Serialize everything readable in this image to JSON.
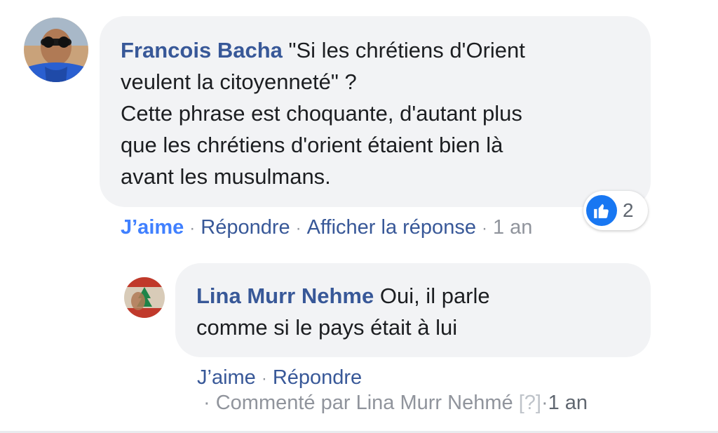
{
  "comment": {
    "author": "Francois Bacha",
    "text": "\"Si les chrétiens d'Orient\nveulent la citoyenneté\" ?\nCette phrase est choquante, d'autant plus\nque les chrétiens d'orient étaient bien là\navant les musulmans.",
    "text_first": "\"Si les chrétiens d'Orient",
    "like_label": "J’aime",
    "reply_label": "Répondre",
    "view_reply_label": "Afficher la réponse",
    "time": "1 an",
    "reactions": {
      "icon": "thumbs-up-icon",
      "count": "2"
    }
  },
  "reply": {
    "author": "Lina Murr Nehme",
    "text_first": "Oui, il parle",
    "text_rest": "comme si le pays était à lui",
    "like_label": "J’aime",
    "reply_label": "Répondre",
    "commented_by": "Commenté par Lina Murr Nehmé",
    "help_marker": "[?]",
    "time": "1 an"
  },
  "colors": {
    "author": "#385898",
    "bubble_bg": "#f2f3f5",
    "like_active": "#4080ff",
    "muted": "#90949c",
    "reaction_blue": "#1877f2"
  }
}
